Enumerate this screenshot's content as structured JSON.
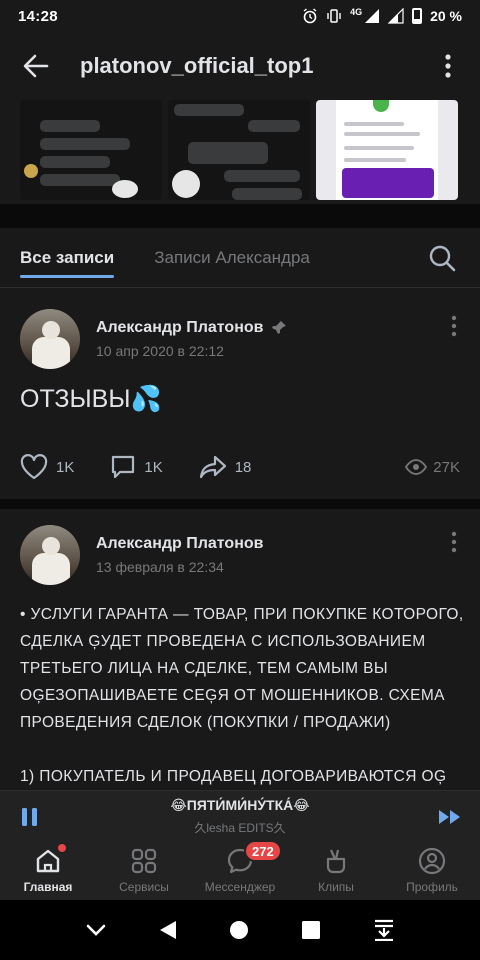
{
  "status_bar": {
    "time": "14:28",
    "network": "4G",
    "battery": "20 %"
  },
  "header": {
    "title": "platonov_official_top1",
    "back_icon": "arrow-left-icon",
    "menu_icon": "more-vertical-icon"
  },
  "photos": [
    {
      "kind": "chat-screenshot"
    },
    {
      "kind": "chat-screenshot"
    },
    {
      "kind": "payment-screenshot"
    }
  ],
  "tabs": {
    "items": [
      {
        "label": "Все записи",
        "active": true
      },
      {
        "label": "Записи Александра",
        "active": false
      }
    ],
    "search_icon": "search-icon"
  },
  "posts": [
    {
      "author": "Александр Платонов",
      "date": "10 апр 2020 в 22:12",
      "pinned": true,
      "text": "ОТЗЫВЫ💦",
      "likes": "1K",
      "comments": "1K",
      "shares": "18",
      "views": "27K"
    },
    {
      "author": "Александр Платонов",
      "date": "13 февраля в 22:34",
      "pinned": false,
      "text_lines": [
        "• УСЛУГИ ГАРАНТА — ТОВАР, ПРИ ПОКУПКЕ КОТОРОГО,",
        "СДЕЛКА ĢУДЕТ ПРОВЕДЕНА С ИСПОЛЬЗОВАНИЕМ",
        "ТРЕТЬЕГО ЛИЦА НА СДЕЛКЕ, ТЕМ САМЫМ ВЫ",
        "ОĢЕЗОПАШИВАЕТЕ СЕĢЯ ОТ МОШЕННИКОВ. СХЕМА",
        "ПРОВЕДЕНИЯ СДЕЛОК (ПОКУПКИ / ПРОДАЖИ)"
      ],
      "text_more": "1) ПОКУПАТЕЛЬ И ПРОДАВЕЦ ДОГОВАРИВАЮТСЯ ОĢ"
    }
  ],
  "player": {
    "title": "😂ПЯТИ́МИ́НУ́ТКА́😂",
    "artist": "久lesha EDITS久"
  },
  "bottom_nav": {
    "items": [
      {
        "label": "Главная",
        "icon": "home-icon",
        "active": true
      },
      {
        "label": "Сервисы",
        "icon": "services-icon",
        "active": false
      },
      {
        "label": "Мессенджер",
        "icon": "messenger-icon",
        "active": false,
        "badge": "272"
      },
      {
        "label": "Клипы",
        "icon": "clips-icon",
        "active": false
      },
      {
        "label": "Профиль",
        "icon": "profile-icon",
        "active": false
      }
    ]
  },
  "colors": {
    "background": "#19191a",
    "accent": "#71aaeb",
    "badge": "#e64646"
  }
}
